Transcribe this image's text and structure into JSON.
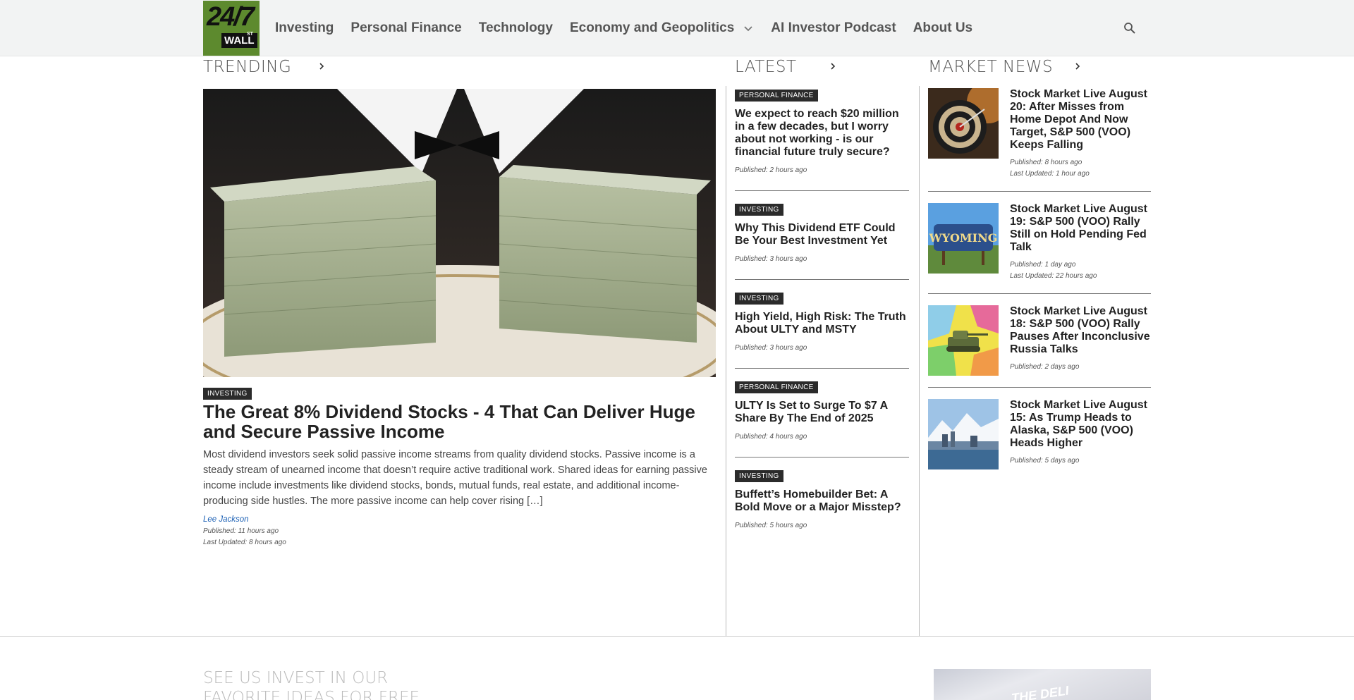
{
  "header": {
    "logo": {
      "line1": "24/7",
      "line2": "WALL",
      "line3": "ST"
    },
    "nav": [
      {
        "label": "Investing"
      },
      {
        "label": "Personal Finance"
      },
      {
        "label": "Technology"
      },
      {
        "label": "Economy and Geopolitics",
        "has_dropdown": true
      },
      {
        "label": "AI Investor Podcast"
      },
      {
        "label": "About Us"
      }
    ],
    "search_icon": "search-icon"
  },
  "trending": {
    "heading": "TRENDING",
    "featured": {
      "badge": "Investing",
      "title": "The Great 8% Dividend Stocks - 4 That Can Deliver Huge and Secure Passive Income",
      "excerpt": "Most dividend investors seek solid passive income streams from quality dividend stocks. Passive income is a steady stream of unearned income that doesn’t require active traditional work. Shared ideas for earning passive income include investments like dividend stocks, bonds, mutual funds, real estate, and additional income-producing side hustles. The more passive income can help cover rising […]",
      "author": "Lee Jackson",
      "published": "Published: 11 hours ago",
      "updated": "Last Updated: 8 hours ago"
    }
  },
  "latest": {
    "heading": "LATEST",
    "items": [
      {
        "badge": "Personal Finance",
        "title": "We expect to reach $20 million in a few decades, but I worry about not working - is our financial future truly secure?",
        "published": "Published: 2 hours ago"
      },
      {
        "badge": "Investing",
        "title": "Why This Dividend ETF Could Be Your Best Investment Yet",
        "published": "Published: 3 hours ago"
      },
      {
        "badge": "Investing",
        "title": "High Yield, High Risk: The Truth About ULTY and MSTY",
        "published": "Published: 3 hours ago"
      },
      {
        "badge": "Personal Finance",
        "title": "ULTY Is Set to Surge To $7 A Share By The End of 2025",
        "published": "Published: 4 hours ago"
      },
      {
        "badge": "Investing",
        "title": "Buffett’s Homebuilder Bet: A Bold Move or a Major Misstep?",
        "published": "Published: 5 hours ago"
      }
    ]
  },
  "market_news": {
    "heading": "MARKET NEWS",
    "items": [
      {
        "title": "Stock Market Live August 20: After Misses from Home Depot And Now Target, S&P 500 (VOO) Keeps Falling",
        "published": "Published: 8 hours ago",
        "updated": "Last Updated: 1 hour ago",
        "thumb": "dartboard"
      },
      {
        "title": "Stock Market Live August 19: S&P 500 (VOO) Rally Still on Hold Pending Fed Talk",
        "published": "Published: 1 day ago",
        "updated": "Last Updated: 22 hours ago",
        "thumb": "wyoming-sign"
      },
      {
        "title": "Stock Market Live August 18: S&P 500 (VOO) Rally Pauses After Inconclusive Russia Talks",
        "published": "Published: 2 days ago",
        "updated": "",
        "thumb": "tank-map"
      },
      {
        "title": "Stock Market Live August 15: As Trump Heads to Alaska, S&P 500 (VOO) Heads Higher",
        "published": "Published: 5 days ago",
        "updated": "",
        "thumb": "alaska-city"
      }
    ]
  },
  "bottom": {
    "heading": "SEE US INVEST IN OUR FAVORITE IDEAS FOR FREE",
    "promo_text": "THE DELI"
  }
}
